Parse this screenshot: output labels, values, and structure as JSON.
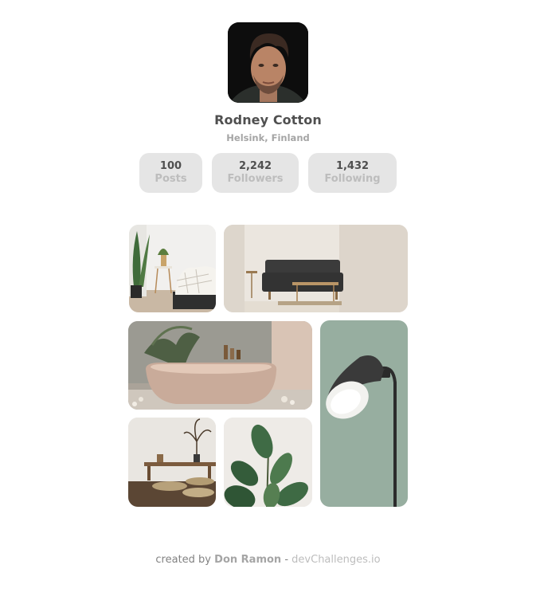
{
  "profile": {
    "name": "Rodney Cotton",
    "location": "Helsink, Finland"
  },
  "stats": [
    {
      "value": "100",
      "label": "Posts"
    },
    {
      "value": "2,242",
      "label": "Followers"
    },
    {
      "value": "1,432",
      "label": "Following"
    }
  ],
  "gallery": [
    {
      "subject": "bedroom-corner"
    },
    {
      "subject": "living-room-sofa"
    },
    {
      "subject": "bathtub"
    },
    {
      "subject": "floor-lamp"
    },
    {
      "subject": "low-table-cushions"
    },
    {
      "subject": "rubber-plant"
    }
  ],
  "footer": {
    "prefix": "created by",
    "author": "Don Ramon",
    "separator": "-",
    "site": "devChallenges.io"
  }
}
